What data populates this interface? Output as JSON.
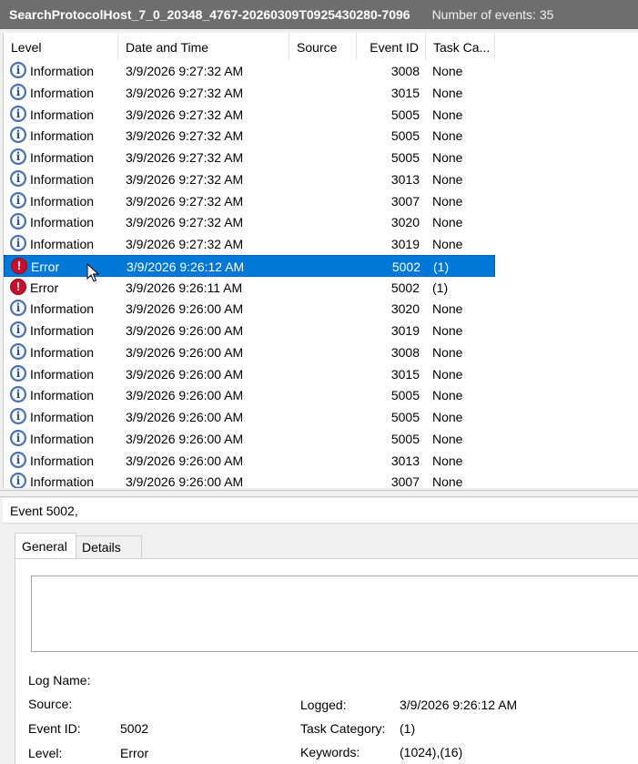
{
  "titlebar": {
    "log_name": "SearchProtocolHost_7_0_20348_4767-20260309T0925430280-7096",
    "event_count": "Number of events: 35"
  },
  "columns": {
    "level": "Level",
    "date": "Date and Time",
    "source": "Source",
    "event_id": "Event ID",
    "task": "Task Ca..."
  },
  "events": [
    {
      "level": "Information",
      "date": "3/9/2026 9:27:32 AM",
      "id": "3008",
      "task": "None",
      "icon": "info-icon"
    },
    {
      "level": "Information",
      "date": "3/9/2026 9:27:32 AM",
      "id": "3015",
      "task": "None",
      "icon": "info-icon"
    },
    {
      "level": "Information",
      "date": "3/9/2026 9:27:32 AM",
      "id": "5005",
      "task": "None",
      "icon": "info-icon"
    },
    {
      "level": "Information",
      "date": "3/9/2026 9:27:32 AM",
      "id": "5005",
      "task": "None",
      "icon": "info-icon"
    },
    {
      "level": "Information",
      "date": "3/9/2026 9:27:32 AM",
      "id": "5005",
      "task": "None",
      "icon": "info-icon"
    },
    {
      "level": "Information",
      "date": "3/9/2026 9:27:32 AM",
      "id": "3013",
      "task": "None",
      "icon": "info-icon"
    },
    {
      "level": "Information",
      "date": "3/9/2026 9:27:32 AM",
      "id": "3007",
      "task": "None",
      "icon": "info-icon"
    },
    {
      "level": "Information",
      "date": "3/9/2026 9:27:32 AM",
      "id": "3020",
      "task": "None",
      "icon": "info-icon"
    },
    {
      "level": "Information",
      "date": "3/9/2026 9:27:32 AM",
      "id": "3019",
      "task": "None",
      "icon": "info-icon"
    },
    {
      "level": "Error",
      "date": "3/9/2026 9:26:12 AM",
      "id": "5002",
      "task": "(1)",
      "icon": "error-icon",
      "selected": true
    },
    {
      "level": "Error",
      "date": "3/9/2026 9:26:11 AM",
      "id": "5002",
      "task": "(1)",
      "icon": "error-icon"
    },
    {
      "level": "Information",
      "date": "3/9/2026 9:26:00 AM",
      "id": "3020",
      "task": "None",
      "icon": "info-icon"
    },
    {
      "level": "Information",
      "date": "3/9/2026 9:26:00 AM",
      "id": "3019",
      "task": "None",
      "icon": "info-icon"
    },
    {
      "level": "Information",
      "date": "3/9/2026 9:26:00 AM",
      "id": "3008",
      "task": "None",
      "icon": "info-icon"
    },
    {
      "level": "Information",
      "date": "3/9/2026 9:26:00 AM",
      "id": "3015",
      "task": "None",
      "icon": "info-icon"
    },
    {
      "level": "Information",
      "date": "3/9/2026 9:26:00 AM",
      "id": "5005",
      "task": "None",
      "icon": "info-icon"
    },
    {
      "level": "Information",
      "date": "3/9/2026 9:26:00 AM",
      "id": "5005",
      "task": "None",
      "icon": "info-icon"
    },
    {
      "level": "Information",
      "date": "3/9/2026 9:26:00 AM",
      "id": "5005",
      "task": "None",
      "icon": "info-icon"
    },
    {
      "level": "Information",
      "date": "3/9/2026 9:26:00 AM",
      "id": "3013",
      "task": "None",
      "icon": "info-icon"
    },
    {
      "level": "Information",
      "date": "3/9/2026 9:26:00 AM",
      "id": "3007",
      "task": "None",
      "icon": "info-icon"
    }
  ],
  "detail": {
    "title": "Event 5002,",
    "tabs": [
      "General",
      "Details"
    ],
    "labels": {
      "log_name": "Log Name:",
      "source": "Source:",
      "event_id": "Event ID:",
      "level": "Level:",
      "logged": "Logged:",
      "task_category": "Task Category:",
      "keywords": "Keywords:"
    },
    "values": {
      "event_id": "5002",
      "level": "Error",
      "logged": "3/9/2026 9:26:12 AM",
      "task_category": "(1)",
      "keywords": "(1024),(16)"
    }
  },
  "colors": {
    "selection": "#0078d7",
    "titlebar": "#6e6e6e",
    "error": "#c8102e",
    "info": "#4a6fa8"
  }
}
